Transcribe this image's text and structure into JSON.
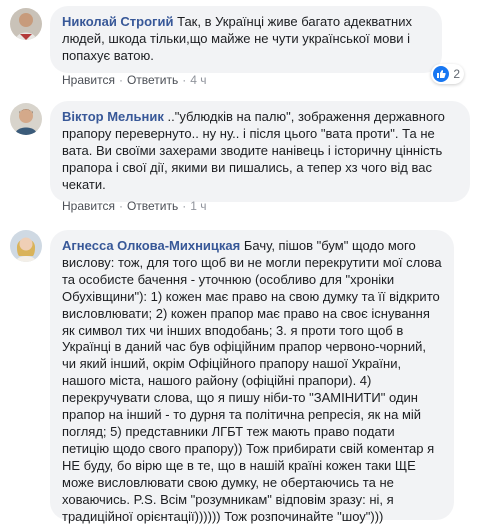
{
  "comments": [
    {
      "author": "Николай Строгий",
      "text": "Так, в Українці живе багато адекватних людей, шкода тільки,що майже не чути української мови і попахує ватою.",
      "actions": {
        "like": "Нравится",
        "reply": "Ответить",
        "time": "4 ч"
      },
      "reactions_count": "2"
    },
    {
      "author": "Віктор Мельник",
      "text": "..\"ублюдків на палю\", зображення державного прапору перевернуто.. ну ну.. і після цього \"вата проти\". Та не вата. Ви своїми захерами зводите нанівець і історичну цінність прапора і свої дії, якими ви пишались, а тепер хз чого від вас чекати.",
      "actions": {
        "like": "Нравится",
        "reply": "Ответить",
        "time": "1 ч"
      }
    },
    {
      "author": "Агнесса Олкова-Михницкая",
      "text": "Бачу, пішов \"бум\" щодо мого вислову: тож, для того щоб ви не могли перекрутити мої слова та особисте бачення - уточнюю (особливо для \"хроніки Обухівщини\"): 1) кожен має право на свою думку та її відкрито висловлювати; 2) кожен прапор має право на своє існування як символ тих чи інших вподобань; 3. я проти того щоб в Українці в даний час був офіційним прапор червоно-чорний, чи який інший, окрім Офіційного прапору нашої України, нашого міста, нашого району (офіційні прапори). 4) перекручувати слова, що я пишу ніби-то \"ЗАМІНИТИ\" один прапор на інший - то дурня та політична репресія, як на мій погляд; 5) представники ЛГБТ теж мають право подати петицію щодо свого прапору)) Тож прибирати свій коментар я НЕ буду, бо вірю ще в те, що в нашій країні кожен таки ЩЕ може висловлювати свою думку, не обертаючись та не ховаючись. P.S. Всім \"розумникам\" відповім зразу: ні, я традиційної орієнтації)))))) Тож розпочинайте \"шоу\")))"
    }
  ]
}
